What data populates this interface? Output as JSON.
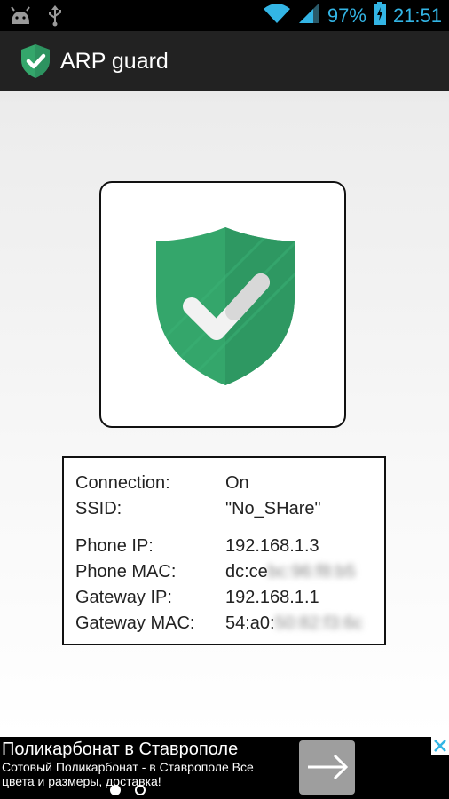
{
  "status_bar": {
    "icons": [
      "android-debug-icon",
      "usb-icon",
      "wifi-icon",
      "signal-icon",
      "battery-charging-icon"
    ],
    "battery": "97%",
    "time": "21:51",
    "accent": "#33b5e5"
  },
  "action_bar": {
    "title": "ARP guard",
    "logo_icon": "shield-check-icon"
  },
  "status_card": {
    "icon": "shield-check-icon",
    "shield_color": "#34a66b"
  },
  "info": {
    "connection_label": "Connection:",
    "connection_value": "On",
    "ssid_label": "SSID:",
    "ssid_value": "\"No_SHare\"",
    "phone_ip_label": "Phone IP:",
    "phone_ip_value": "192.168.1.3",
    "phone_mac_label": "Phone MAC:",
    "phone_mac_value": "dc:ce",
    "phone_mac_hidden": "bc:96:f8:b5",
    "gateway_ip_label": "Gateway IP:",
    "gateway_ip_value": "192.168.1.1",
    "gateway_mac_label": "Gateway MAC:",
    "gateway_mac_value": "54:a0:",
    "gateway_mac_hidden": "50:82:f3:6c"
  },
  "ad": {
    "title": "Поликарбонат в Ставрополе",
    "body": "Сотовый Поликарбонат - в Ставрополе Все цвета и размеры, доставка!",
    "action_icon": "arrow-right-icon",
    "close_icon": "close-icon"
  }
}
